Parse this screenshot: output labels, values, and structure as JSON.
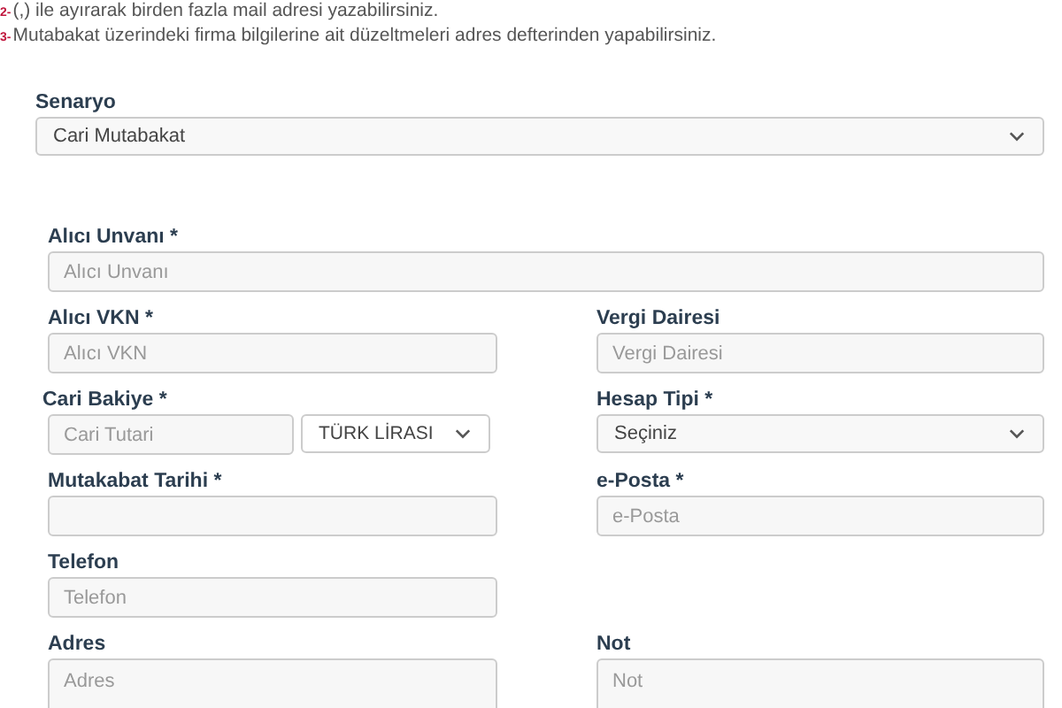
{
  "notes": [
    {
      "number": "2-",
      "text": "(,) ile ayırarak birden fazla mail adresi yazabilirsiniz."
    },
    {
      "number": "3-",
      "text": "Mutabakat üzerindeki firma bilgilerine ait düzeltmeleri adres defterinden yapabilirsiniz."
    }
  ],
  "scenario": {
    "label": "Senaryo",
    "value": "Cari Mutabakat"
  },
  "rows": [
    {
      "kind": "wide",
      "fields": [
        {
          "kind": "input",
          "label": "Alıcı Unvanı *",
          "placeholder": "Alıcı Unvanı"
        }
      ]
    },
    {
      "kind": "pair",
      "fields": [
        {
          "kind": "input",
          "label": "Alıcı VKN *",
          "placeholder": "Alıcı VKN"
        },
        {
          "kind": "input",
          "label": "Vergi Dairesi",
          "placeholder": "Vergi Dairesi"
        }
      ]
    },
    {
      "kind": "pair",
      "fields": [
        {
          "kind": "money",
          "label": "Cari Bakiye *",
          "placeholder": "Cari Tutari",
          "currency": "TÜRK LİRASI"
        },
        {
          "kind": "select",
          "label": "Hesap Tipi *",
          "value": "Seçiniz"
        }
      ]
    },
    {
      "kind": "pair",
      "fields": [
        {
          "kind": "input",
          "label": "Mutakabat Tarihi *"
        },
        {
          "kind": "input",
          "label": "e-Posta *",
          "placeholder": "e-Posta"
        }
      ]
    },
    {
      "kind": "pair",
      "fields": [
        {
          "kind": "input",
          "label": "Telefon",
          "placeholder": "Telefon"
        }
      ]
    },
    {
      "kind": "pair",
      "fields": [
        {
          "kind": "textarea",
          "label": "Adres",
          "placeholder": "Adres"
        },
        {
          "kind": "textarea",
          "label": "Not",
          "placeholder": "Not"
        }
      ]
    }
  ]
}
